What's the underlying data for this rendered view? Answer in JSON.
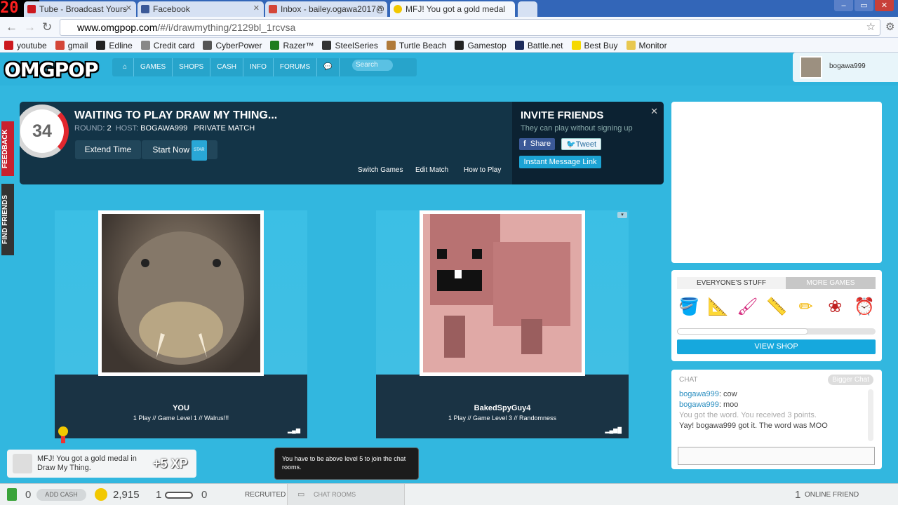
{
  "browser": {
    "fps_counter": "20",
    "tabs": [
      {
        "label": "Tube - Broadcast Yours",
        "favicon": "youtube-icon",
        "color": "#cc181e"
      },
      {
        "label": "Facebook",
        "favicon": "facebook-icon",
        "color": "#3b5998"
      },
      {
        "label": "Inbox - bailey.ogawa2017@",
        "favicon": "gmail-icon",
        "color": "#d44638"
      },
      {
        "label": "MFJ! You got a gold medal",
        "favicon": "omgpop-icon",
        "color": "#f2c800"
      }
    ],
    "url_host": "www.omgpop.com",
    "url_path": "/#/i/drawmything/2129bl_1rcvsa",
    "bookmarks": [
      {
        "label": "youtube",
        "icon": "youtube-icon",
        "color": "#cc181e"
      },
      {
        "label": "gmail",
        "icon": "gmail-icon",
        "color": "#d44638"
      },
      {
        "label": "Edline",
        "icon": "edline-icon",
        "color": "#222222"
      },
      {
        "label": "Credit card",
        "icon": "creditcard-icon",
        "color": "#888888"
      },
      {
        "label": "CyberPower",
        "icon": "cyberpower-icon",
        "color": "#555555"
      },
      {
        "label": "Razer™",
        "icon": "razer-icon",
        "color": "#1e7d1e"
      },
      {
        "label": "SteelSeries",
        "icon": "steelseries-icon",
        "color": "#333333"
      },
      {
        "label": "Turtle Beach",
        "icon": "turtlebeach-icon",
        "color": "#b07a3a"
      },
      {
        "label": "Gamestop",
        "icon": "gamestop-icon",
        "color": "#222222"
      },
      {
        "label": "Battle.net",
        "icon": "battlenet-icon",
        "color": "#1c2a5a"
      },
      {
        "label": "Best Buy",
        "icon": "bestbuy-icon",
        "color": "#f5d800"
      },
      {
        "label": "Monitor",
        "icon": "folder-icon",
        "color": "#e8c850"
      }
    ]
  },
  "site": {
    "logo": "OMGPOP",
    "nav": [
      "GAMES",
      "SHOPS",
      "CASH",
      "INFO",
      "FORUMS"
    ],
    "search_placeholder": "Search",
    "username": "bogawa999"
  },
  "side_tabs": {
    "feedback": "FEEDBACK",
    "find_friends": "FIND FRIENDS"
  },
  "game": {
    "timer": "34",
    "title": "WAITING TO PLAY DRAW MY THING...",
    "round_label": "ROUND:",
    "round": "2",
    "host_label": "HOST:",
    "host": "BOGAWA999",
    "match_type": "PRIVATE MATCH",
    "extend_time": "Extend Time",
    "start_now": "Start Now",
    "star_badge": "STAR",
    "links": [
      "Switch Games",
      "Edit Match",
      "How to Play"
    ]
  },
  "invite": {
    "title": "INVITE FRIENDS",
    "subtitle": "They can play without signing up",
    "share": "Share",
    "tweet": "Tweet",
    "im_link": "Instant Message Link",
    "close": "✕"
  },
  "players": [
    {
      "name": "YOU",
      "info": "1 Play // Game Level 1 // Walrus!!!"
    },
    {
      "name": "BakedSpyGuy4",
      "info": "1 Play // Game Level 3 // Randomness"
    }
  ],
  "shop": {
    "tab_active": "EVERYONE'S STUFF",
    "tab_other": "MORE GAMES",
    "items": [
      "paint-bucket-icon",
      "ruler-triangle-icon",
      "brush-icon",
      "t-square-icon",
      "pencil-icon",
      "wreath-icon",
      "clock-icon"
    ],
    "progress_fraction": 0.66,
    "view_shop": "VIEW SHOP"
  },
  "chat": {
    "header": "CHAT",
    "bigger_chat": "Bigger Chat",
    "lines": [
      {
        "user": "bogawa999",
        "text": ": cow"
      },
      {
        "user": "bogawa999",
        "text": ": moo"
      },
      {
        "user": "",
        "text": "You got the word. You received 3 points."
      },
      {
        "user": "",
        "text": "Yay! bogawa999 got it. The word was MOO"
      }
    ]
  },
  "notification": {
    "text": "MFJ!  You got a gold medal in Draw My Thing.",
    "xp": "+5 XP"
  },
  "tooltip": "You have to be above level 5 to join the chat rooms.",
  "bottom": {
    "cash": "0",
    "add_cash": "ADD CASH",
    "coins": "2,915",
    "level": "1",
    "recruited_count": "0",
    "recruited": "RECRUITED",
    "chat_rooms": "CHAT ROOMS",
    "online_count": "1",
    "online_friend": "ONLINE FRIEND"
  }
}
